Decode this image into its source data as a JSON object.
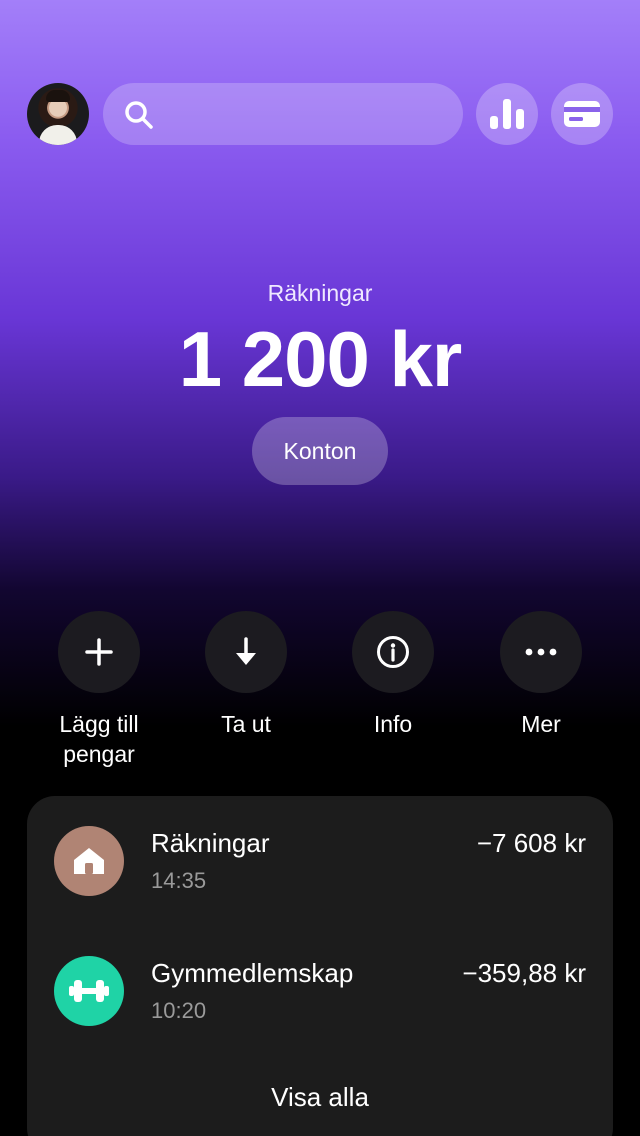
{
  "header": {
    "avatar_icon": "profile-photo",
    "search_icon": "search-icon",
    "stats_icon": "bar-chart-icon",
    "card_icon": "card-icon"
  },
  "balance": {
    "label": "Räkningar",
    "amount": "1 200 kr",
    "accounts_button": "Konton"
  },
  "actions": [
    {
      "label": "Lägg till\npengar",
      "icon": "plus-icon"
    },
    {
      "label": "Ta ut",
      "icon": "arrow-down-icon"
    },
    {
      "label": "Info",
      "icon": "info-icon"
    },
    {
      "label": "Mer",
      "icon": "more-icon"
    }
  ],
  "transactions": [
    {
      "name": "Räkningar",
      "time": "14:35",
      "amount": "−7 608 kr",
      "icon": "house-icon",
      "color": "#b08474"
    },
    {
      "name": "Gymmedlemskap",
      "time": "10:20",
      "amount": "−359,88 kr",
      "icon": "dumbbell-icon",
      "color": "#1fd3a6"
    }
  ],
  "show_all": "Visa alla"
}
